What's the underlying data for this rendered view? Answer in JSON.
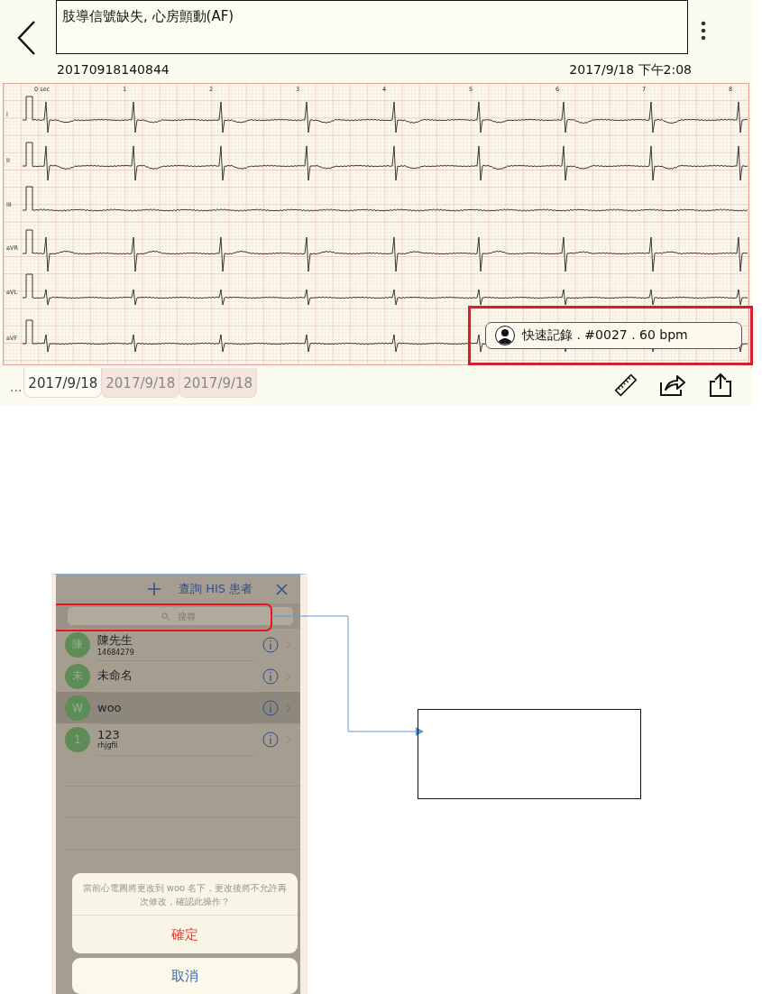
{
  "record": {
    "diagnosis": "肢導信號缺失, 心房顫動(AF)",
    "record_id": "20170918140844",
    "datetime": "2017/9/18 下午2:08"
  },
  "ecg": {
    "time_labels": [
      "0 sec",
      "1",
      "2",
      "3",
      "4",
      "5",
      "6",
      "7",
      "8"
    ],
    "leads": [
      "I",
      "II",
      "III",
      "aVR",
      "aVL",
      "aVF"
    ]
  },
  "patient_badge": {
    "text": "快速記錄 . #0027 . 60 bpm"
  },
  "tabs": {
    "more": "...",
    "items": [
      {
        "label": "2017/9/18",
        "selected": true
      },
      {
        "label": "2017/9/18",
        "selected": false
      },
      {
        "label": "2017/9/18",
        "selected": false
      }
    ]
  },
  "phone": {
    "title": "查詢 HIS 患者",
    "search": {
      "placeholder": "搜尋"
    },
    "patients": [
      {
        "avatar": "陳",
        "name": "陳先生",
        "detail": "14684279",
        "selected": false
      },
      {
        "avatar": "未",
        "name": "未命名",
        "selected": false
      },
      {
        "avatar": "W",
        "name": "woo",
        "selected": true
      },
      {
        "avatar": "1",
        "name": "123",
        "detail": "rhjgfii",
        "selected": false
      }
    ],
    "alert": {
      "message": "當前心電圖將更改到 woo 名下，更改後將不允許再次修改，確認此操作？",
      "confirm": "確定",
      "cancel": "取消"
    }
  }
}
